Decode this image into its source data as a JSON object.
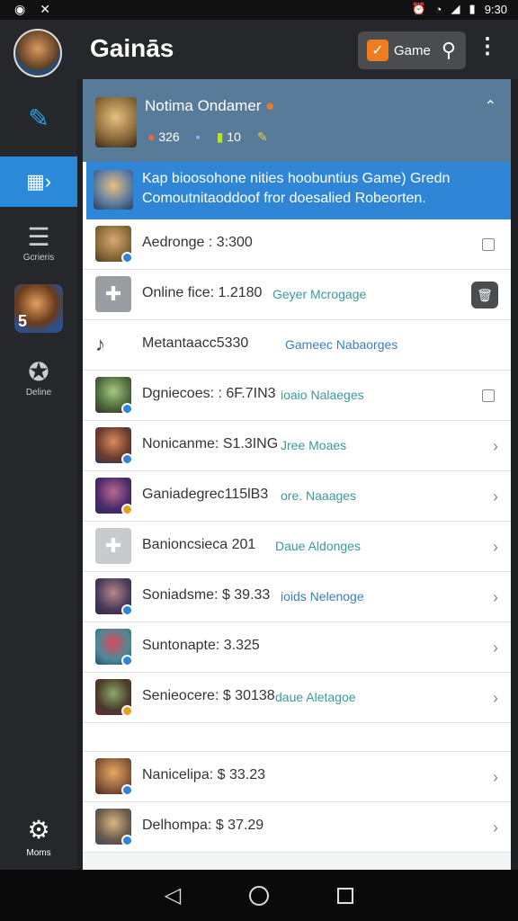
{
  "status_bar": {
    "time": "9:30",
    "signal": "5"
  },
  "app": {
    "title": "Gainās"
  },
  "sidebar": {
    "items": [
      {
        "label": "",
        "icon": "edit-icon"
      },
      {
        "label": "",
        "icon": "grid-arrow-icon"
      },
      {
        "label": "Gcrieris",
        "icon": "chat-icon"
      },
      {
        "label": "5",
        "icon": "avatar"
      },
      {
        "label": "Deline",
        "icon": "badge-icon"
      }
    ],
    "bottom": {
      "label": "Moms",
      "icon": "gear-icon"
    }
  },
  "toolbar": {
    "game_label": "Game"
  },
  "header_card": {
    "title": "Notima Ondamer",
    "stat1": "326",
    "stat2": "",
    "stat3": "10",
    "stat4": "✎"
  },
  "highlight": {
    "line1": "Kap bioosohone nities hoobuntius Game) Gredn",
    "line2": "Comoutnitaoddoof fror doesalied Robeorten."
  },
  "rows": [
    {
      "name": "Aedronge : 3:300",
      "desc": "",
      "right": "checkbox",
      "thumb": "char1"
    },
    {
      "name": "Online fice: 1.2180",
      "desc": "Geyer Mcrogage",
      "right": "trash",
      "thumb": "grey"
    },
    {
      "name": "Metantaacc5330",
      "desc": "Gameec Nabaorges",
      "right": "",
      "thumb": "note"
    },
    {
      "name": "Dgniecoes: : 6F.7IN3",
      "desc": "ioaio Nalaeges",
      "right": "checkbox",
      "thumb": "char2"
    },
    {
      "name": "Nonicanme: S1.3ING",
      "desc": "Jree Moaes",
      "right": "chevron",
      "thumb": "char3"
    },
    {
      "name": "Ganiadegrec115lB3",
      "desc": "ore. Naaages",
      "right": "chevron",
      "thumb": "char4"
    },
    {
      "name": "Banioncsieca 201",
      "desc": "Daue Aldonges",
      "right": "chevron",
      "thumb": "grey-light"
    },
    {
      "name": "Soniadsme: $ 39.33",
      "desc": "ioids Nelenoge",
      "right": "chevron",
      "thumb": "char5"
    },
    {
      "name": "Suntonapte: 3.325",
      "desc": "",
      "right": "chevron",
      "thumb": "char6"
    },
    {
      "name": "Senieocere: $ 30138",
      "desc": "daue Aletagoe",
      "right": "chevron",
      "thumb": "char7"
    },
    {
      "name": "Nanicelipa: $ 33.23",
      "desc": "",
      "right": "chevron",
      "thumb": "char8"
    },
    {
      "name": "Delhompa: $ 37.29",
      "desc": "",
      "right": "chevron",
      "thumb": "char9"
    }
  ],
  "colors": {
    "accent": "#2f86d6",
    "orange": "#f07c22",
    "header": "#577b98"
  }
}
